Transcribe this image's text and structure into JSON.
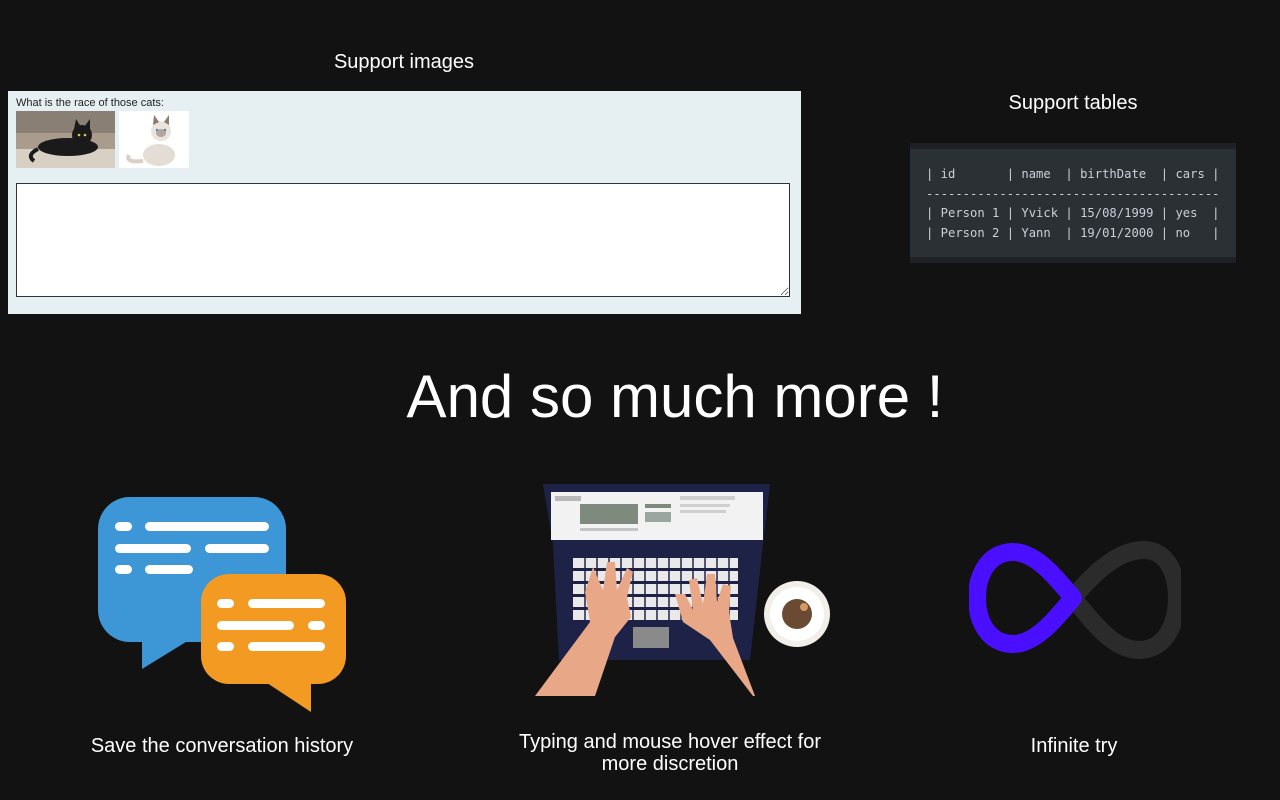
{
  "images_section": {
    "title": "Support images",
    "question": "What is the race of those cats:",
    "thumbnails": [
      {
        "icon": "black-cat-photo"
      },
      {
        "icon": "white-cat-photo"
      }
    ],
    "textarea_value": ""
  },
  "tables_section": {
    "title": "Support tables",
    "table_text": "| id       | name  | birthDate  | cars |\n----------------------------------------\n| Person 1 | Yvick | 15/08/1999 | yes  |\n| Person 2 | Yann  | 19/01/2000 | no   |",
    "columns": [
      "id",
      "name",
      "birthDate",
      "cars"
    ],
    "rows": [
      [
        "Person 1",
        "Yvick",
        "15/08/1999",
        "yes"
      ],
      [
        "Person 2",
        "Yann",
        "19/01/2000",
        "no"
      ]
    ]
  },
  "headline": "And so much more !",
  "features": [
    {
      "label": "Save the conversation history",
      "icon": "chat-bubbles-icon"
    },
    {
      "label": "Typing and mouse hover effect for more discretion",
      "icon": "laptop-typing-icon"
    },
    {
      "label": "Infinite try",
      "icon": "infinity-icon"
    }
  ],
  "colors": {
    "background": "#121212",
    "chat_blue": "#3d97d6",
    "chat_orange": "#f29a22",
    "infinity_purple": "#4a0fff",
    "infinity_gray": "#2b2b2b",
    "laptop_navy": "#1f2247"
  }
}
